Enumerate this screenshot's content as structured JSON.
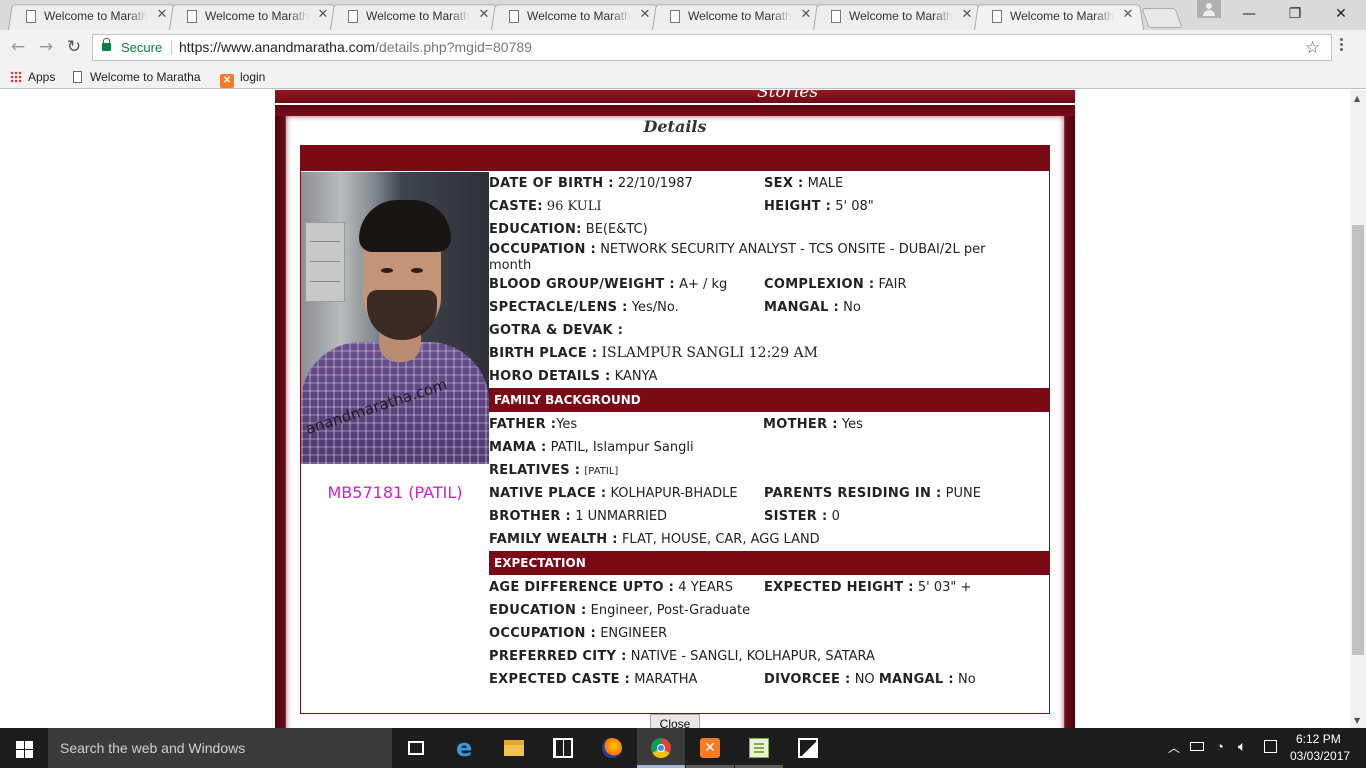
{
  "browser": {
    "tabs": [
      {
        "title": "Welcome to Maratha"
      },
      {
        "title": "Welcome to Maratha"
      },
      {
        "title": "Welcome to Maratha"
      },
      {
        "title": "Welcome to Maratha"
      },
      {
        "title": "Welcome to Maratha"
      },
      {
        "title": "Welcome to Maratha"
      },
      {
        "title": "Welcome to Maratha",
        "active": true
      }
    ],
    "secure_label": "Secure",
    "url_host": "https://www.anandmaratha.com",
    "url_path": "/details.php?mgid=80789",
    "bookmarks": {
      "apps": "Apps",
      "welcome": "Welcome to Maratha",
      "login": "login"
    }
  },
  "site": {
    "topnav_stories": "Stories",
    "topnav_fragment_left": "~ ~ ~",
    "topnav_fragment_right": "~ ~ ~"
  },
  "profile": {
    "heading": "Details",
    "photo_watermark": "anandmaratha.com",
    "member_id": "MB57181 (PATIL)",
    "personal": {
      "dob_label": "DATE OF BIRTH :",
      "dob": "22/10/1987",
      "sex_label": "SEX :",
      "sex": "MALE",
      "caste_label": "CASTE:",
      "caste": "96 KULI",
      "height_label": "HEIGHT :",
      "height": "5' 08\"",
      "education_label": "EDUCATION:",
      "education": "BE(E&TC)",
      "occupation_label": "OCCUPATION :",
      "occupation": "NETWORK SECURITY ANALYST - TCS ONSITE - DUBAI/2L per month",
      "blood_label": "BLOOD GROUP/WEIGHT :",
      "blood": "A+ / kg",
      "complexion_label": "COMPLEXION :",
      "complexion": "FAIR",
      "spectacle_label": "SPECTACLE/LENS :",
      "spectacle": "Yes/No.",
      "mangal_label": "MANGAL :",
      "mangal": "No",
      "gotra_label": "GOTRA & DEVAK :",
      "gotra": "",
      "birthplace_label": "BIRTH PLACE :",
      "birthplace": "ISLAMPUR SANGLI 12:29 AM",
      "horo_label": "HORO DETAILS :",
      "horo": "KANYA"
    },
    "family": {
      "section_title": "FAMILY BACKGROUND",
      "father_label": "FATHER :",
      "father": "Yes",
      "mother_label": "MOTHER :",
      "mother": "Yes",
      "mama_label": "MAMA :",
      "mama": "PATIL, Islampur Sangli",
      "relatives_label": "RELATIVES :",
      "relatives": "[PATIL]",
      "native_label": "NATIVE PLACE :",
      "native": "KOLHAPUR-BHADLE",
      "parents_label": "PARENTS RESIDING IN :",
      "parents": "PUNE",
      "brother_label": "BROTHER :",
      "brother": "1 UNMARRIED",
      "sister_label": "SISTER :",
      "sister": "0",
      "wealth_label": "FAMILY WEALTH :",
      "wealth": "FLAT, HOUSE, CAR, AGG LAND"
    },
    "expectation": {
      "section_title": "EXPECTATION",
      "age_label": "AGE DIFFERENCE UPTO :",
      "age": "4 YEARS",
      "exp_height_label": "EXPECTED HEIGHT :",
      "exp_height": "5' 03\" +",
      "education_label": "EDUCATION :",
      "education": "Engineer, Post-Graduate",
      "occupation_label": "OCCUPATION :",
      "occupation": "ENGINEER",
      "city_label": "PREFERRED CITY :",
      "city": "NATIVE - SANGLI, KOLHAPUR, SATARA",
      "caste_label": "EXPECTED CASTE :",
      "caste": "MARATHA",
      "divorcee_label": "DIVORCEE :",
      "divorcee": "NO",
      "mangal_label": "MANGAL :",
      "mangal": "No"
    },
    "close_label": "Close"
  },
  "taskbar": {
    "search_placeholder": "Search the web and Windows",
    "time": "6:12 PM",
    "date": "03/03/2017",
    "apps": [
      "task-view",
      "edge",
      "file-explorer",
      "store",
      "firefox",
      "chrome",
      "xampp",
      "notepad-plus",
      "photos"
    ]
  },
  "colors": {
    "maroon": "#7a0a14",
    "member_id": "#cc22cc",
    "secure_green": "#0b8043"
  }
}
